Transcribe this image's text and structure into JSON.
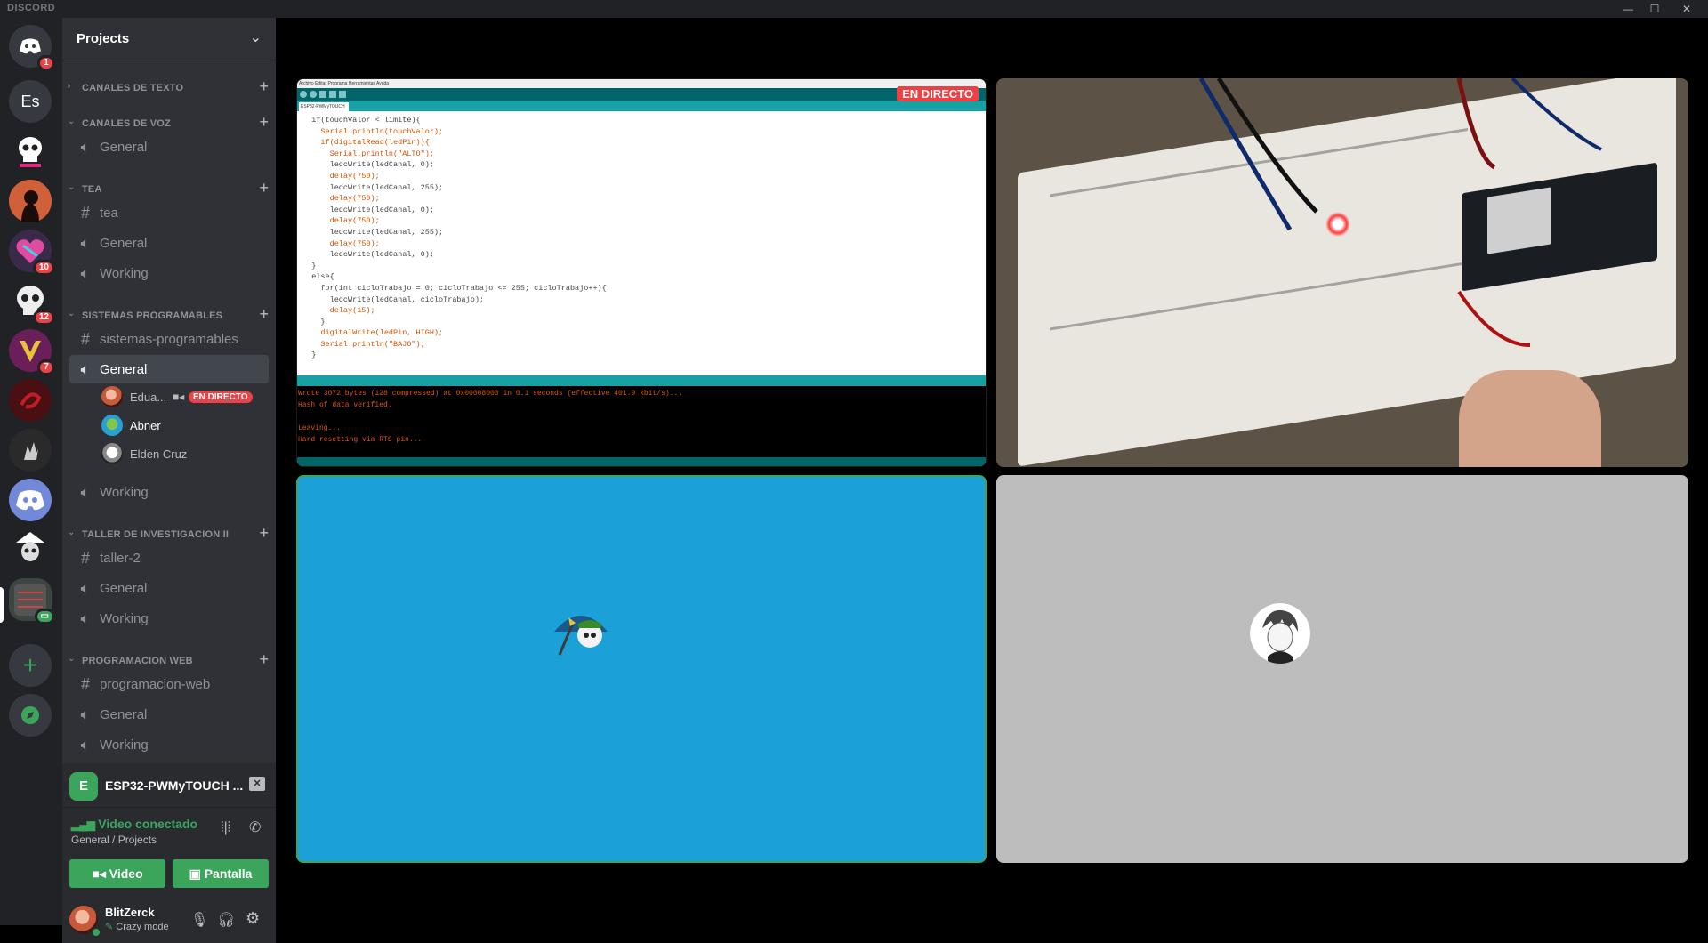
{
  "app": {
    "brand": "DISCORD"
  },
  "window_controls": [
    "—",
    "☐",
    "✕"
  ],
  "servers": [
    {
      "name": "home",
      "label": "",
      "badge": "1",
      "color": "#5865f2"
    },
    {
      "name": "es",
      "label": "Es",
      "badge": "",
      "color": "#36393f"
    },
    {
      "name": "skull-server",
      "label": "",
      "badge": "",
      "color": "#202225"
    },
    {
      "name": "profile-server",
      "label": "",
      "badge": "",
      "color": "#c8502e"
    },
    {
      "name": "heart-server",
      "label": "",
      "badge": "10",
      "color": "#e04ba0"
    },
    {
      "name": "white-skull-server",
      "label": "",
      "badge": "12",
      "color": "#202225"
    },
    {
      "name": "v-server",
      "label": "",
      "badge": "7",
      "color": "#7a2a6a"
    },
    {
      "name": "red-server",
      "label": "",
      "badge": "",
      "color": "#5a1010"
    },
    {
      "name": "hand-server",
      "label": "",
      "badge": "",
      "color": "#303030"
    },
    {
      "name": "discord-server",
      "label": "",
      "badge": "",
      "color": "#7289da"
    },
    {
      "name": "pirate-server",
      "label": "",
      "badge": "",
      "color": "#202225"
    },
    {
      "name": "projects-server",
      "label": "",
      "badge": "",
      "color": "#2a2c30"
    }
  ],
  "rail_actions": {
    "add": "+",
    "explore": "⌖"
  },
  "guild": {
    "name": "Projects"
  },
  "categories": {
    "text": "CANALES DE TEXTO",
    "voice": "CANALES DE VOZ",
    "tea": "TEA",
    "sistemas": "SISTEMAS PROGRAMABLES",
    "taller": "TALLER DE INVESTIGACION II",
    "web": "PROGRAMACION WEB"
  },
  "channels": {
    "voice_general": "General",
    "tea_text": "tea",
    "tea_general": "General",
    "tea_working": "Working",
    "sis_text": "sistemas-programables",
    "sis_general": "General",
    "sis_working": "Working",
    "taller_text": "taller-2",
    "taller_general": "General",
    "taller_working": "Working",
    "web_text": "programacion-web",
    "web_general": "General",
    "web_working": "Working"
  },
  "voice_users": [
    {
      "name": "Edua...",
      "live": "EN DIRECTO"
    },
    {
      "name": "Abner"
    },
    {
      "name": "Elden Cruz"
    }
  ],
  "stream_panel": {
    "title": "ESP32-PWMyTOUCH ...",
    "icon_letter": "E"
  },
  "voice_panel": {
    "status": "Video conectado",
    "location": "General / Projects",
    "video_btn": "Video",
    "screen_btn": "Pantalla"
  },
  "user": {
    "name": "BlitZerck",
    "status": "Crazy mode"
  },
  "stage": {
    "live_label": "EN DIRECTO",
    "ide_menu": "Archivo  Editar  Programa  Herramientas  Ayuda",
    "ide_tab": "ESP32-PWMyTOUCH",
    "code_lines": [
      "  if(touchValor < limite){",
      "    Serial.println(touchValor);",
      "    if(digitalRead(ledPin)){",
      "      Serial.println(\"ALTO\");",
      "      ledcWrite(ledCanal, 0);",
      "      delay(750);",
      "      ledcWrite(ledCanal, 255);",
      "      delay(750);",
      "      ledcWrite(ledCanal, 0);",
      "      delay(750);",
      "      ledcWrite(ledCanal, 255);",
      "      delay(750);",
      "      ledcWrite(ledCanal, 0);",
      "  }",
      "  else{",
      "    for(int cicloTrabajo = 0; cicloTrabajo <= 255; cicloTrabajo++){",
      "      ledcWrite(ledCanal, cicloTrabajo);",
      "      delay(15);",
      "    }",
      "    digitalWrite(ledPin, HIGH);",
      "    Serial.println(\"BAJO\");",
      "  }"
    ],
    "console_lines": [
      "Wrote 3072 bytes (128 compressed) at 0x00008000 in 0.1 seconds (effective 401.9 kbit/s)...",
      "Hash of data verified.",
      "",
      "Leaving...",
      "Hard resetting via RTS pin..."
    ]
  }
}
